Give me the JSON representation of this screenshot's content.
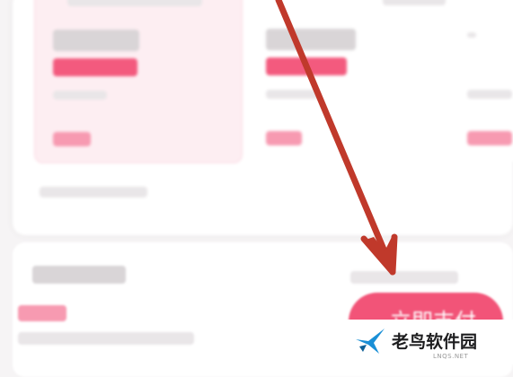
{
  "pay_button": {
    "label": "立即支付"
  },
  "annotation": {
    "arrow_color": "#c0392b"
  },
  "watermark": {
    "brand_text": "老鸟软件园",
    "domain_text": "LNQS.NET",
    "logo_icon": "bird-icon"
  },
  "colors": {
    "accent_pink": "#f25478",
    "selected_plan_bg": "#fdeef2"
  }
}
